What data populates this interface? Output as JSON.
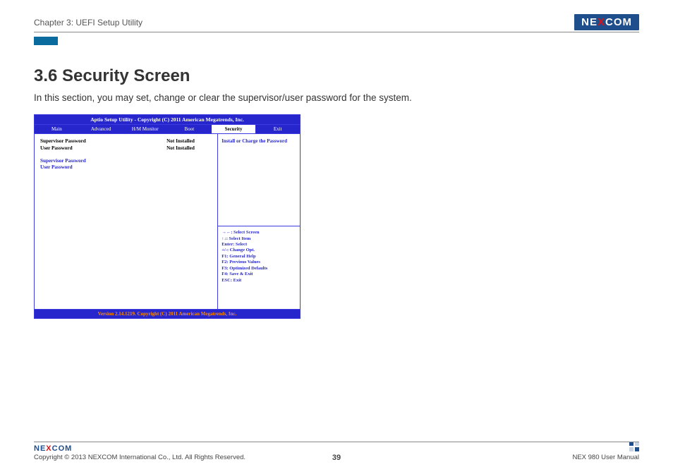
{
  "header": {
    "chapter": "Chapter 3: UEFI Setup Utility",
    "brand_pre": "NE",
    "brand_x": "X",
    "brand_post": "COM"
  },
  "section": {
    "title": "3.6 Security Screen",
    "intro": "In this section, you may set, change or clear the supervisor/user password for the system."
  },
  "bios": {
    "title": "Aptio Setup Utility - Copyright (C) 2011 American Megatrends, Inc.",
    "tabs": [
      "Main",
      "Advanced",
      "H/M Monitor",
      "Boot",
      "Security",
      "Exit"
    ],
    "active_tab": "Security",
    "rows": [
      {
        "label": "Supervisor Password",
        "value": "Not Installed"
      },
      {
        "label": "User Password",
        "value": "Not Installed"
      }
    ],
    "actions": [
      "Supervisor Password",
      "User Password"
    ],
    "help": "Install or Charge the Password",
    "keys": [
      "→←: Select Screen",
      "↑↓: Select Item",
      "Enter: Select",
      "+/-: Change Opt.",
      "F1: General Help",
      "F2: Previous Values",
      "F3: Optimized Defaults",
      "F4: Save & Exit",
      "ESC: Exit"
    ],
    "footer": "Version 2.14.1219. Copyright (C) 2011 American Megatrends, Inc."
  },
  "footer": {
    "copyright": "Copyright © 2013 NEXCOM International Co., Ltd. All Rights Reserved.",
    "page": "39",
    "manual": "NEX 980 User Manual"
  }
}
